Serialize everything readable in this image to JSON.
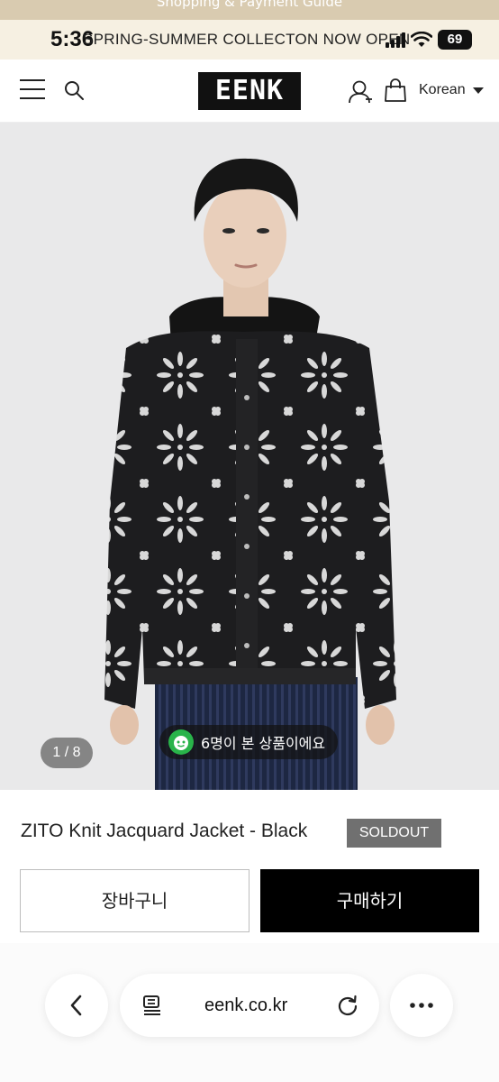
{
  "status_bar": {
    "time": "5:36",
    "battery": "69",
    "icons": [
      "signal-icon",
      "wifi-icon",
      "battery-icon"
    ]
  },
  "promo": {
    "top_text": "Shopping & Payment Guide",
    "banner_text": "SPRING-SUMMER COLLECTON NOW OPEN"
  },
  "header": {
    "logo": "EENK",
    "language": "Korean",
    "icons": [
      "menu-icon",
      "search-icon",
      "user-icon",
      "shopping-bag-icon"
    ]
  },
  "gallery": {
    "counter": "1 / 8",
    "viewers_text": "6명이 본 상품이에요"
  },
  "product": {
    "title": "ZITO Knit Jacquard Jacket - Black",
    "status_badge": "SOLDOUT"
  },
  "actions": {
    "cart_label": "장바구니",
    "buy_label": "구매하기"
  },
  "browser": {
    "url": "eenk.co.kr"
  },
  "colors": {
    "promo_bg": "#f6f0e2",
    "image_bg": "#e9e9ea",
    "buy_button": "#000000",
    "soldout_badge": "#707070",
    "viewer_icon": "#29b34a"
  }
}
